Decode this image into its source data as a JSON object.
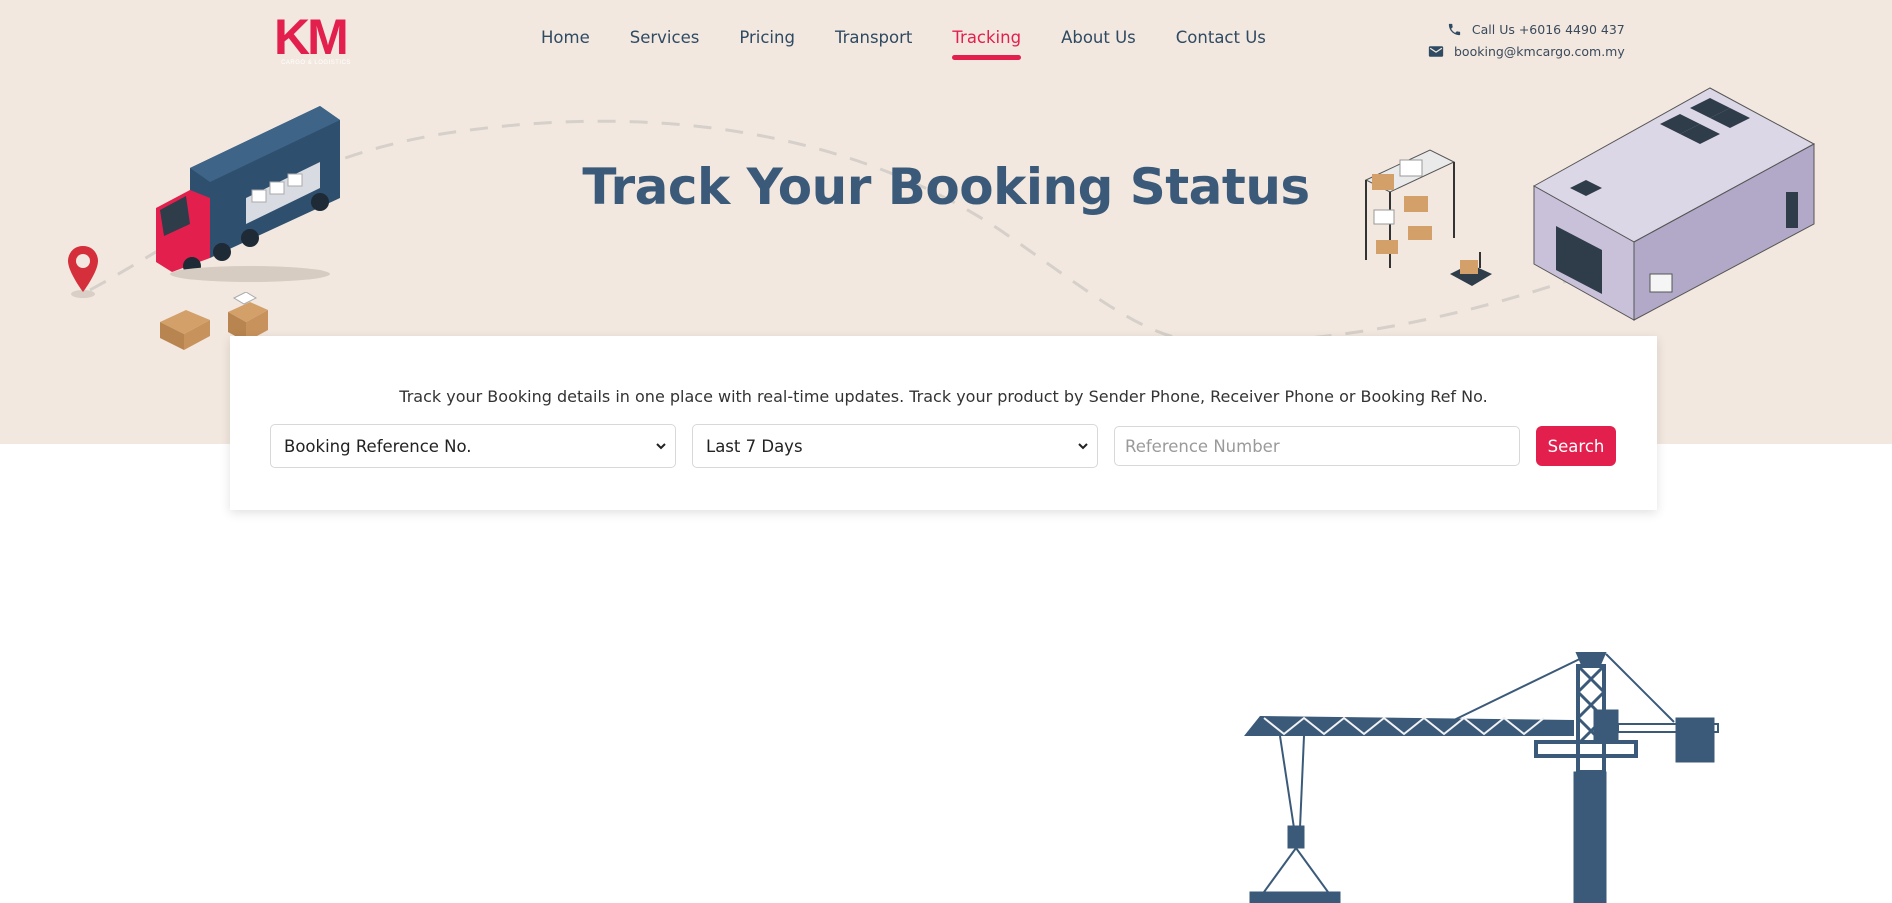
{
  "brand": {
    "logo_text": "KM",
    "logo_subtext": "CARGO & LOGISTICS"
  },
  "nav": {
    "items": [
      {
        "label": "Home",
        "active": false
      },
      {
        "label": "Services",
        "active": false
      },
      {
        "label": "Pricing",
        "active": false
      },
      {
        "label": "Transport",
        "active": false
      },
      {
        "label": "Tracking",
        "active": true
      },
      {
        "label": "About Us",
        "active": false
      },
      {
        "label": "Contact Us",
        "active": false
      }
    ]
  },
  "contact": {
    "phone": "Call Us +6016 4490 437",
    "email": "booking@kmcargo.com.my",
    "phone_icon": "phone-icon",
    "email_icon": "mail-icon"
  },
  "hero": {
    "title": "Track Your Booking Status"
  },
  "tracking": {
    "description": "Track your Booking details in one place with real-time updates. Track your product by Sender Phone, Receiver Phone or Booking Ref No.",
    "search_type": "Booking Reference No.",
    "date_range": "Last 7 Days",
    "reference_placeholder": "Reference Number",
    "search_button": "Search"
  },
  "colors": {
    "accent": "#e3204d",
    "navy": "#3b5a7a",
    "hero_bg": "#f2e8df"
  }
}
